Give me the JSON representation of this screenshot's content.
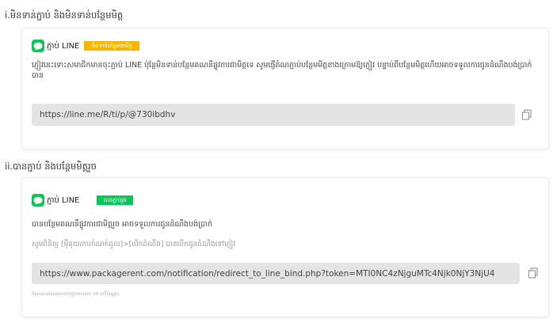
{
  "sections": [
    {
      "title": "i.មិនទាន់ភ្ជាប់ និងមិនទាន់បន្ថែមមិត្ត",
      "account_name": "ភ្ជាប់ LINE",
      "badge": "មិនទាន់បន្ថែមជាមិត្ត",
      "description": "ភ្ញៀវនេះទោះសមាជិកមានចុះភ្ជាប់ LINE ប៉ុន្តែមិនទាន់បន្ថែមគណនីផ្លូវការជាមិត្តទេ សូមផ្ញើតំណភ្ជាប់បន្ថែមមិត្តខាងក្រោមឱ្យភ្ញៀវ បន្ទាប់ពីបន្ថែមមិត្តហើយអាចទទួលការជូនដំណឹងបង់ប្រាក់បាន",
      "url": "https://line.me/R/ti/p/@730ibdhv"
    },
    {
      "title": "ii.បានភ្ជាប់ និងបន្ថែមមិត្តរួច",
      "account_name": "ភ្ជាប់ LINE",
      "badge": "បានភ្ជាប់រួច",
      "description": "បានបន្ថែមគណនីផ្លូវការជាមិត្តរួច អាចទទួលការជូនដំណឹងបង់ប្រាក់",
      "hint": "សូមពិនិត្យ [ម៉ឺនុយ/ការកំណត់ជួល]>[បើកដំណឹង] បានបើកជូនដំណឹងទៅភ្ញៀវ",
      "url": "https://www.packagerent.com/notification/redirect_to_line_bind.php?token=MTI0NC4zNjguMTc4Njk0NjY3NjU4",
      "expiry_note": "តំណនេះមានសុពលភាពក្នុងរយៈពេល 30 នាទីប៉ុណ្ណោះ"
    }
  ],
  "colors": {
    "line_green": "#06c755",
    "badge_yellow": "#f4b400",
    "url_bg": "#e4e4e4"
  }
}
